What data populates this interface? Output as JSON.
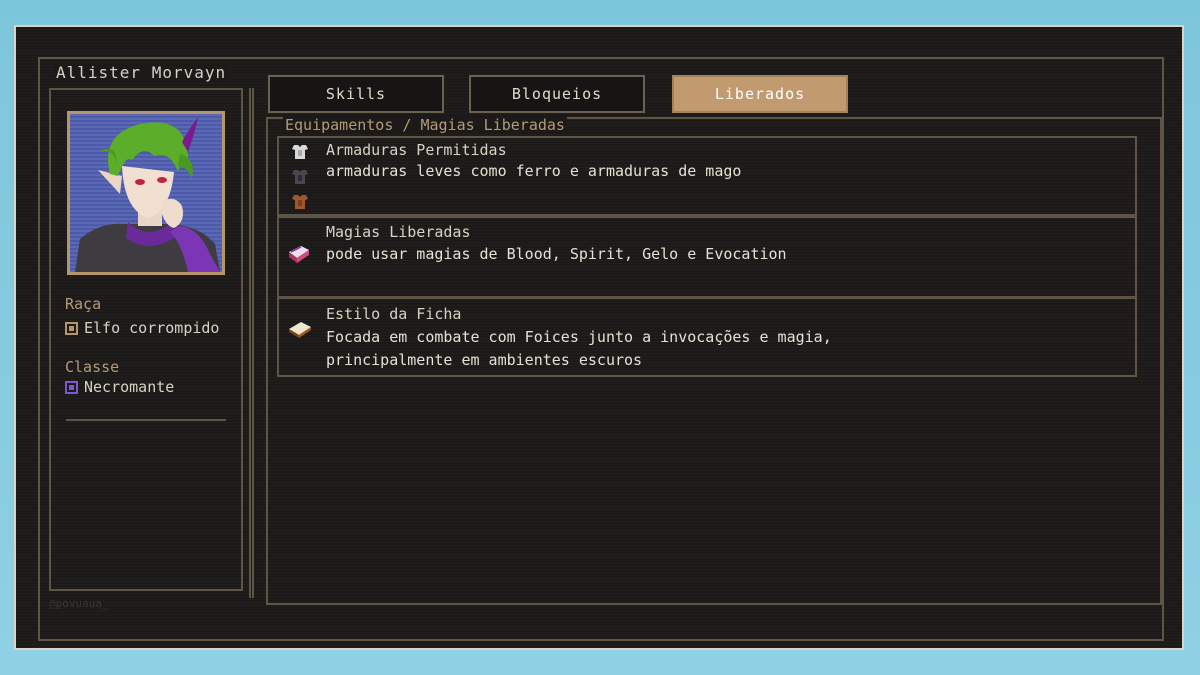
{
  "character": {
    "name": "Allister Morvayn",
    "race_label": "Raça",
    "race_value": "Elfo corrompido",
    "race_color": "#b5956e",
    "class_label": "Classe",
    "class_value": "Necromante",
    "class_color": "#7a58d0"
  },
  "tabs": [
    {
      "label": "Skills",
      "active": false
    },
    {
      "label": "Bloqueios",
      "active": false
    },
    {
      "label": "Liberados",
      "active": true
    }
  ],
  "section_title": "Equipamentos / Magias Liberadas",
  "cards": [
    {
      "title": "Armaduras Permitidas",
      "lines": [
        "armaduras leves como ferro e armaduras de mago"
      ],
      "icons": [
        "iron-chestplate-icon",
        "dark-chestplate-icon",
        "leather-chestplate-icon"
      ]
    },
    {
      "title": "Magias Liberadas",
      "lines": [
        "pode usar magias de Blood, Spirit, Gelo e Evocation"
      ],
      "icons": [
        "spellbook-icon"
      ]
    },
    {
      "title": "Estilo da Ficha",
      "lines": [
        "Focada em combate com Foices junto a invocações e magia,",
        "principalmente em ambientes escuros"
      ],
      "icons": [
        "book-icon"
      ]
    }
  ],
  "watermark": "@povuaua_"
}
